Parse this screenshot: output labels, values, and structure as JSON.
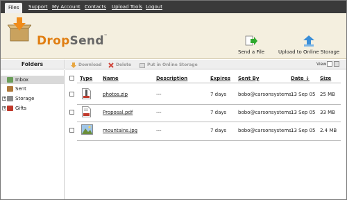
{
  "nav": {
    "tabs": [
      {
        "label": "Files",
        "active": true
      },
      {
        "label": "Support",
        "active": false
      },
      {
        "label": "My Account",
        "active": false
      },
      {
        "label": "Contacts",
        "active": false
      },
      {
        "label": "Upload Tools",
        "active": false
      },
      {
        "label": "Logout",
        "active": false
      }
    ]
  },
  "brand": {
    "part1": "Drop",
    "part2": "Send",
    "tm": "™"
  },
  "header_actions": {
    "send_file": "Send a File",
    "upload_online": "Upload to Online Storage"
  },
  "folders": {
    "title": "Folders",
    "items": [
      {
        "label": "Inbox",
        "selected": true,
        "expandable": false
      },
      {
        "label": "Sent",
        "selected": false,
        "expandable": false
      },
      {
        "label": "Storage",
        "selected": false,
        "expandable": true
      },
      {
        "label": "Gifts",
        "selected": false,
        "expandable": true
      }
    ]
  },
  "toolbar": {
    "download": "Download",
    "delete": "Delete",
    "put_online": "Put in Online Storage",
    "view_label": "View"
  },
  "table": {
    "headers": {
      "type": "Type",
      "name": "Name",
      "description": "Description",
      "expires": "Expires",
      "sent_by": "Sent By",
      "date": "Date",
      "date_sort": "↓",
      "size": "Size"
    },
    "rows": [
      {
        "type": "zip",
        "name": "photos.zip",
        "description": "---",
        "expires": "7 days",
        "sent_by": "bobo@carsonsystems.",
        "date": "13 Sep 05",
        "size": "25 MB"
      },
      {
        "type": "pdf",
        "name": "Proposal.pdf",
        "description": "---",
        "expires": "7 days",
        "sent_by": "bobo@carsonsystems.",
        "date": "13 Sep 05",
        "size": "33 MB"
      },
      {
        "type": "jpg",
        "name": "mountains.jpg",
        "description": "---",
        "expires": "7 days",
        "sent_by": "bobo@carsonsystems.",
        "date": "13 Sep 05",
        "size": "2.4 MB"
      }
    ]
  },
  "colors": {
    "nav_bg": "#3a3a3a",
    "header_bg": "#f4efdf",
    "brand_orange": "#e07e12",
    "selected_row": "#d9d9d9"
  }
}
